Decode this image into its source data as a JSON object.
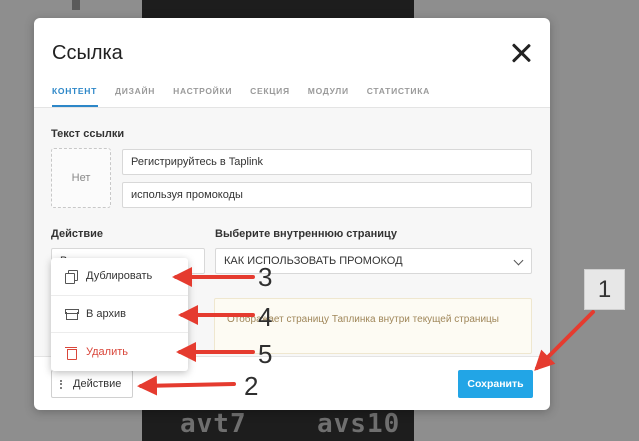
{
  "backdrop": {
    "overlay_left": "avt7",
    "overlay_right": "avs10"
  },
  "modal": {
    "title": "Ссылка",
    "tabs": [
      {
        "label": "КОНТЕНТ",
        "active": true
      },
      {
        "label": "ДИЗАЙН"
      },
      {
        "label": "НАСТРОЙКИ"
      },
      {
        "label": "СЕКЦИЯ"
      },
      {
        "label": "МОДУЛИ"
      },
      {
        "label": "СТАТИСТИКА"
      }
    ],
    "link_text_label": "Текст ссылки",
    "thumbnail_label": "Нет",
    "link_text_line1": "Регистрируйтесь в Taplink",
    "link_text_line2": "используя промокоды",
    "action_label": "Действие",
    "action_select_value": "Внутренняя страница",
    "page_label": "Выберите внутреннюю страницу",
    "page_select_value": "КАК ИСПОЛЬЗОВАТЬ ПРОМОКОД",
    "note_text": "Отображает страницу Таплинка внутри текущей страницы",
    "footer_action_button": "Действие",
    "save_button": "Сохранить"
  },
  "menu": {
    "items": [
      {
        "label": "Дублировать",
        "icon": "copy-icon"
      },
      {
        "label": "В архив",
        "icon": "archive-icon"
      },
      {
        "label": "Удалить",
        "icon": "trash-icon",
        "color": "#d9463a"
      }
    ]
  },
  "annotations": {
    "n1": "1",
    "n2": "2",
    "n3": "3",
    "n4": "4",
    "n5": "5",
    "arrow_color": "#e53b2f"
  },
  "colors": {
    "accent": "#2d87c8",
    "save": "#22a5e6"
  }
}
